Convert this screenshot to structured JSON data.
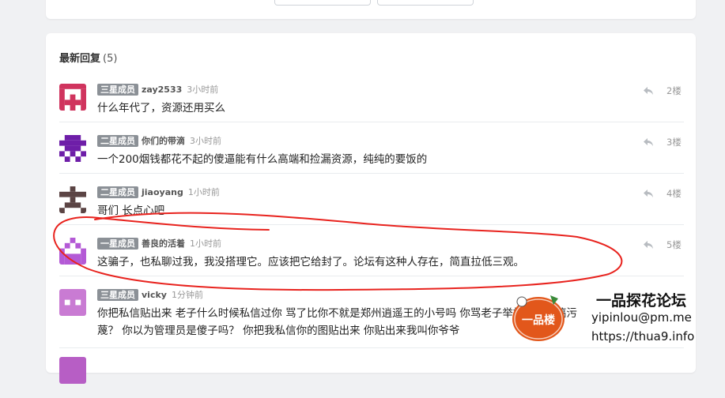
{
  "section": {
    "title": "最新回复",
    "count": "(5)"
  },
  "replies": [
    {
      "badge": "三星成员",
      "user": "zay2533",
      "time": "3小时前",
      "text": "什么年代了，资源还用买么",
      "floor": "2楼",
      "avatar_color": "#d0345e"
    },
    {
      "badge": "二星成员",
      "user": "你们的带滴",
      "time": "3小时前",
      "text": "一个200烟钱都花不起的傻逼能有什么高端和捡漏资源，纯纯的要饭的",
      "floor": "3楼",
      "avatar_color": "#6e1ea8"
    },
    {
      "badge": "二星成员",
      "user": "jiaoyang",
      "time": "1小时前",
      "text": "哥们 长点心吧",
      "floor": "4楼",
      "avatar_color": "#5b4444"
    },
    {
      "badge": "一星成员",
      "user": "善良的活着",
      "time": "1小时前",
      "text": "这骗子，也私聊过我，我没搭理它。应该把它给封了。论坛有这种人存在，简直拉低三观。",
      "floor": "5楼",
      "avatar_color": "#b45ad6"
    },
    {
      "badge": "三星成员",
      "user": "vicky",
      "time": "1分钟前",
      "text": "你把私信贴出来 老子什么时候私信过你 骂了比你不就是郑州逍遥王的小号吗 你骂老子举报封了就搞污",
      "text2": "蔑？ 你以为管理员是傻子吗？ 你把我私信你的图贴出来 你贴出来我叫你爷爷",
      "floor": "",
      "avatar_color": "#c97bd3"
    }
  ],
  "watermark": {
    "title": "一品探花论坛",
    "email": "yipinlou@pm.me",
    "url": "https://thua9.info",
    "logo_text": "一品楼"
  },
  "colors": {
    "annotation": "#e8231e",
    "badge": "#8b9096"
  }
}
